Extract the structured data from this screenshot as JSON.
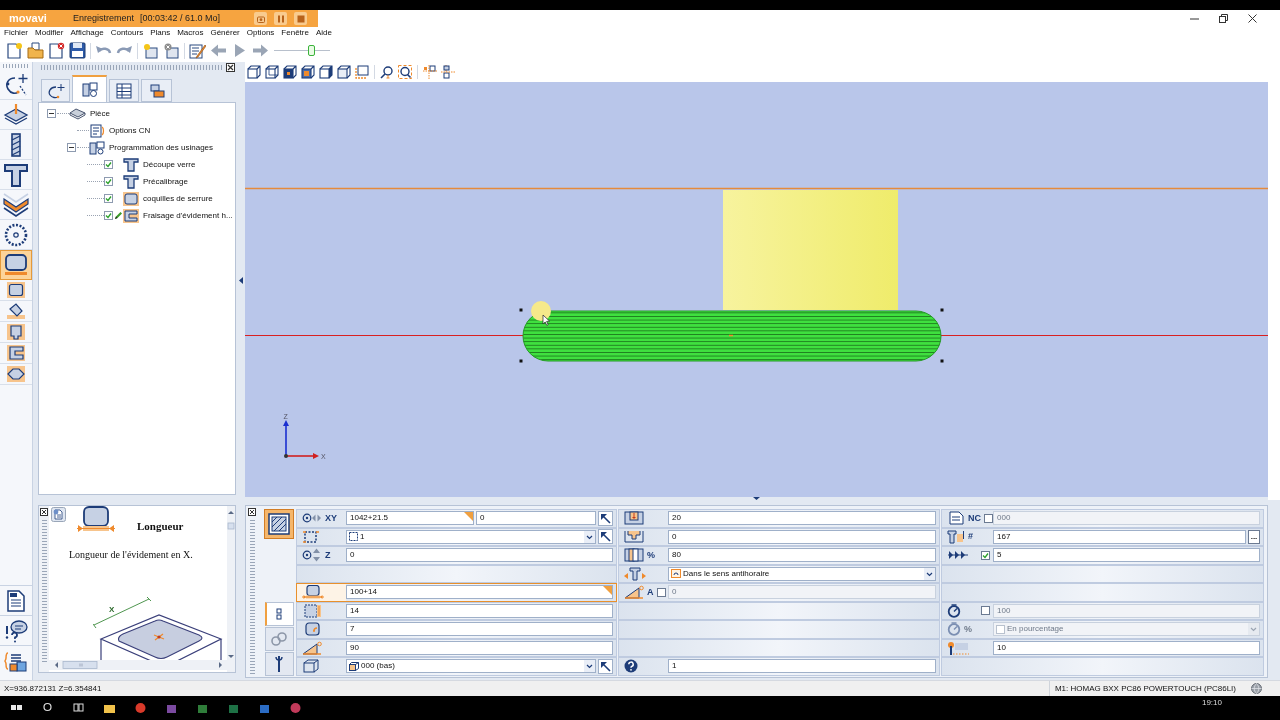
{
  "recorder": {
    "brand": "movavi",
    "status": "Enregistrement",
    "timer": "[00:03:42 / 61.0 Mo]"
  },
  "menu": [
    "Fichier",
    "Modifier",
    "Affichage",
    "Contours",
    "Plans",
    "Macros",
    "Générer",
    "Options",
    "Fenêtre",
    "Aide"
  ],
  "toolbar": {
    "zoom_slider": {
      "level": 0.7
    }
  },
  "tool_palette": [
    {
      "selected": false
    },
    {
      "selected": false
    },
    {
      "selected": false
    },
    {
      "selected": false
    },
    {
      "selected": false
    },
    {
      "selected": false
    },
    {
      "selected": true
    },
    {
      "selected": false
    },
    {
      "selected": false
    },
    {
      "selected": false
    },
    {
      "selected": false
    },
    {
      "selected": false
    }
  ],
  "tree_panel": {
    "tabs": [
      {
        "selected": false
      },
      {
        "selected": true
      },
      {
        "selected": false
      },
      {
        "selected": false
      }
    ],
    "tree": [
      {
        "label": "Pièce",
        "kind": "part",
        "expanded": true,
        "children": [
          {
            "label": "Options CN",
            "kind": "settings"
          },
          {
            "label": "Programmation des usinages",
            "kind": "program",
            "expanded": true,
            "children": [
              {
                "label": "Découpe verre",
                "kind": "cutter",
                "checked": true,
                "editing": false
              },
              {
                "label": "Précalibrage",
                "kind": "cutter",
                "checked": true,
                "editing": false
              },
              {
                "label": "coquilles de serrure",
                "kind": "pocket",
                "checked": true,
                "editing": false
              },
              {
                "label": "Fraisage d'évidement h...",
                "kind": "recess",
                "checked": true,
                "editing": true
              }
            ]
          }
        ]
      }
    ]
  },
  "viewport": {
    "axis_labels": [
      "Z",
      "X"
    ]
  },
  "help_panel": {
    "title": "Longueur",
    "text": "Longueur de l'évidement en X.",
    "figure_label": "X"
  },
  "params": {
    "side_tabs": [
      {
        "selected": true
      },
      {
        "selected": false
      },
      {
        "selected": false
      }
    ],
    "columns": [
      [
        {
          "kind": "pair",
          "label": "XY",
          "value": "1042+21.5",
          "value_2": "0",
          "formula": true,
          "selected": false,
          "disabled": false
        },
        {
          "kind": "select",
          "value": "1",
          "pick": true,
          "disabled": false
        },
        {
          "kind": "input",
          "label": "Z",
          "value": "0",
          "formula": false,
          "selected": false,
          "disabled": false
        },
        {
          "kind": "empty"
        },
        {
          "kind": "input",
          "value": "100+14",
          "formula": true,
          "selected": true,
          "disabled": false
        },
        {
          "kind": "input",
          "value": "14",
          "formula": false,
          "selected": false,
          "disabled": false
        },
        {
          "kind": "input",
          "value": "7",
          "formula": false,
          "selected": false,
          "disabled": false
        },
        {
          "kind": "input",
          "value": "90",
          "formula": false,
          "selected": false,
          "disabled": false
        },
        {
          "kind": "select",
          "value": "000 (bas)",
          "pick": true,
          "disabled": false
        }
      ],
      [
        {
          "kind": "input",
          "value": "20",
          "formula": false,
          "selected": false,
          "disabled": false
        },
        {
          "kind": "input",
          "value": "0",
          "formula": false,
          "selected": false,
          "disabled": false
        },
        {
          "kind": "input",
          "label": "%",
          "value": "80",
          "formula": false,
          "selected": false,
          "disabled": false
        },
        {
          "kind": "select",
          "value": "Dans le sens antihoraire",
          "pick": false,
          "disabled": false
        },
        {
          "kind": "check_input",
          "label": "A",
          "checked": false,
          "value": "0",
          "disabled": true
        },
        {
          "kind": "empty"
        },
        {
          "kind": "empty"
        },
        {
          "kind": "empty"
        },
        {
          "kind": "input",
          "value": "1",
          "formula": false,
          "selected": false,
          "disabled": false
        }
      ],
      [
        {
          "kind": "check_input",
          "label": "NC",
          "checked": false,
          "value": "000",
          "disabled": true
        },
        {
          "kind": "input_more",
          "label": "#",
          "value": "167",
          "button": "...",
          "formula": false,
          "selected": false,
          "disabled": false
        },
        {
          "kind": "check_input",
          "checked": true,
          "value": "5",
          "disabled": false
        },
        {
          "kind": "empty"
        },
        {
          "kind": "empty"
        },
        {
          "kind": "check_input",
          "checked": false,
          "value": "100",
          "disabled": true
        },
        {
          "kind": "select",
          "label": "%",
          "value": "En pourcentage",
          "pick": false,
          "disabled": true
        },
        {
          "kind": "input",
          "value": "10",
          "formula": false,
          "selected": false,
          "disabled": false
        },
        {
          "kind": "empty"
        }
      ]
    ]
  },
  "status_bar": {
    "coordinates": "X=936.872131 Z=6.354841",
    "machine": "M1: HOMAG BXX PC86 POWERTOUCH (PC86LI)"
  },
  "taskbar": {
    "clock": "19:10"
  }
}
